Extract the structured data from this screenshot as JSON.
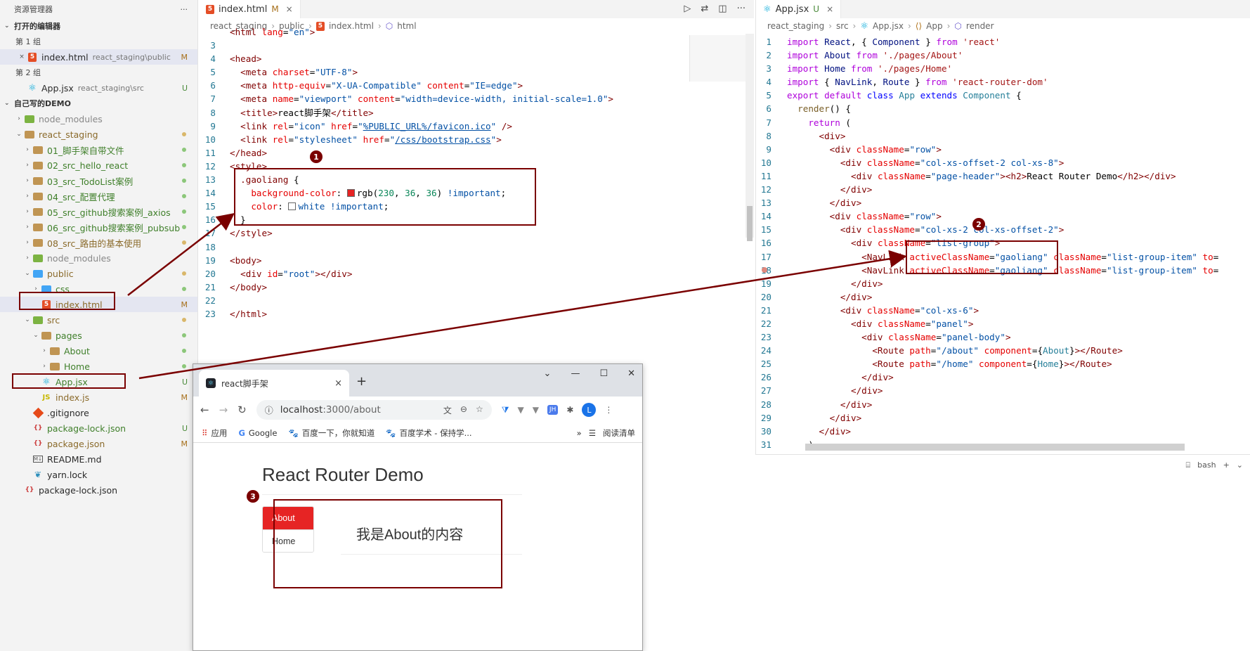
{
  "sidebar": {
    "title": "资源管理器",
    "more": "···",
    "open_editors": {
      "label": "打开的编辑器",
      "group1": "第 1 组",
      "group1_file": {
        "name": "index.html",
        "path": "react_staging\\public",
        "status": "M"
      },
      "group2": "第 2 组",
      "group2_file": {
        "name": "App.jsx",
        "path": "react_staging\\src",
        "status": "U"
      }
    },
    "workspace": {
      "label": "自己写的DEMO",
      "items": [
        {
          "name": "node_modules",
          "icon": "folder-green",
          "indent": 1,
          "chevron": "›",
          "status": ""
        },
        {
          "name": "react_staging",
          "icon": "folder",
          "indent": 1,
          "chevron": "⌄",
          "status": "dot-m"
        },
        {
          "name": "01_脚手架自带文件",
          "icon": "folder",
          "indent": 2,
          "chevron": "›",
          "status": "dot"
        },
        {
          "name": "02_src_hello_react",
          "icon": "folder",
          "indent": 2,
          "chevron": "›",
          "status": "dot"
        },
        {
          "name": "03_src_TodoList案例",
          "icon": "folder",
          "indent": 2,
          "chevron": "›",
          "status": "dot"
        },
        {
          "name": "04_src_配置代理",
          "icon": "folder",
          "indent": 2,
          "chevron": "›",
          "status": "dot"
        },
        {
          "name": "05_src_github搜索案例_axios",
          "icon": "folder",
          "indent": 2,
          "chevron": "›",
          "status": "dot"
        },
        {
          "name": "06_src_github搜索案例_pubsub",
          "icon": "folder",
          "indent": 2,
          "chevron": "›",
          "status": "dot"
        },
        {
          "name": "08_src_路由的基本使用",
          "icon": "folder",
          "indent": 2,
          "chevron": "›",
          "status": "dot-m"
        },
        {
          "name": "node_modules",
          "icon": "folder-green",
          "indent": 2,
          "chevron": "›",
          "status": ""
        },
        {
          "name": "public",
          "icon": "folder-blue",
          "indent": 2,
          "chevron": "⌄",
          "status": "dot-m"
        },
        {
          "name": "css",
          "icon": "folder-blue",
          "indent": 3,
          "chevron": "›",
          "status": "dot"
        },
        {
          "name": "index.html",
          "icon": "html",
          "indent": 3,
          "chevron": "",
          "status": "M"
        },
        {
          "name": "src",
          "icon": "folder-green",
          "indent": 2,
          "chevron": "⌄",
          "status": "dot-m"
        },
        {
          "name": "pages",
          "icon": "folder",
          "indent": 3,
          "chevron": "⌄",
          "status": "dot"
        },
        {
          "name": "About",
          "icon": "folder",
          "indent": 4,
          "chevron": "›",
          "status": "dot"
        },
        {
          "name": "Home",
          "icon": "folder",
          "indent": 4,
          "chevron": "›",
          "status": "dot"
        },
        {
          "name": "App.jsx",
          "icon": "react",
          "indent": 3,
          "chevron": "",
          "status": "U"
        },
        {
          "name": "index.js",
          "icon": "js",
          "indent": 3,
          "chevron": "",
          "status": "M"
        },
        {
          "name": ".gitignore",
          "icon": "git",
          "indent": 2,
          "chevron": "",
          "status": ""
        },
        {
          "name": "package-lock.json",
          "icon": "json",
          "indent": 2,
          "chevron": "",
          "status": "U"
        },
        {
          "name": "package.json",
          "icon": "json",
          "indent": 2,
          "chevron": "",
          "status": "M"
        },
        {
          "name": "README.md",
          "icon": "md",
          "indent": 2,
          "chevron": "",
          "status": ""
        },
        {
          "name": "yarn.lock",
          "icon": "yarn",
          "indent": 2,
          "chevron": "",
          "status": ""
        },
        {
          "name": "package-lock.json",
          "icon": "json",
          "indent": 1,
          "chevron": "",
          "status": ""
        }
      ]
    }
  },
  "editor1": {
    "tab_name": "index.html",
    "tab_status": "M",
    "breadcrumb": [
      "react_staging",
      "public",
      "index.html",
      "html"
    ],
    "lines": [
      {
        "n": "",
        "html": "<span class=\"t\">&lt;html</span> <span class=\"a\">lang</span>=<span class=\"s\">\"en\"</span><span class=\"t\">&gt;</span>"
      },
      {
        "n": "3",
        "html": ""
      },
      {
        "n": "4",
        "html": "<span class=\"t\">&lt;head&gt;</span>"
      },
      {
        "n": "5",
        "html": "  <span class=\"t\">&lt;meta</span> <span class=\"a\">charset</span>=<span class=\"s\">\"UTF-8\"</span><span class=\"t\">&gt;</span>"
      },
      {
        "n": "6",
        "html": "  <span class=\"t\">&lt;meta</span> <span class=\"a\">http-equiv</span>=<span class=\"s\">\"X-UA-Compatible\"</span> <span class=\"a\">content</span>=<span class=\"s\">\"IE=edge\"</span><span class=\"t\">&gt;</span>"
      },
      {
        "n": "7",
        "html": "  <span class=\"t\">&lt;meta</span> <span class=\"a\">name</span>=<span class=\"s\">\"viewport\"</span> <span class=\"a\">content</span>=<span class=\"s\">\"width=device-width, initial-scale=1.0\"</span><span class=\"t\">&gt;</span>"
      },
      {
        "n": "8",
        "html": "  <span class=\"t\">&lt;title&gt;</span>react脚手架<span class=\"t\">&lt;/title&gt;</span>"
      },
      {
        "n": "9",
        "html": "  <span class=\"t\">&lt;link</span> <span class=\"a\">rel</span>=<span class=\"s\">\"icon\"</span> <span class=\"a\">href</span>=<span class=\"s\">\"<u>%PUBLIC_URL%/favicon.ico</u>\"</span> <span class=\"t\">/&gt;</span>"
      },
      {
        "n": "10",
        "html": "  <span class=\"t\">&lt;link</span> <span class=\"a\">rel</span>=<span class=\"s\">\"stylesheet\"</span> <span class=\"a\">href</span>=<span class=\"s\">\"<u>/css/bootstrap.css</u>\"</span><span class=\"t\">&gt;</span>"
      },
      {
        "n": "11",
        "html": "<span class=\"t\">&lt;/head&gt;</span>"
      },
      {
        "n": "12",
        "html": "<span class=\"t\">&lt;style&gt;</span>"
      },
      {
        "n": "13",
        "html": "  <span class=\"t\">.gaoliang</span> {"
      },
      {
        "n": "14",
        "html": "    <span class=\"a\">background-color</span>: <span class=\"swatch\" style=\"background:#e62424\"></span>rgb(<span class=\"n\">230</span>, <span class=\"n\">36</span>, <span class=\"n\">36</span>) <span class=\"s\">!important</span>;"
      },
      {
        "n": "15",
        "html": "    <span class=\"a\">color</span>: <span class=\"swatch\" style=\"background:#ffffff\"></span><span class=\"s\">white</span> <span class=\"s\">!important</span>;"
      },
      {
        "n": "16",
        "html": "  }"
      },
      {
        "n": "17",
        "html": "<span class=\"t\">&lt;/style&gt;</span>"
      },
      {
        "n": "18",
        "html": ""
      },
      {
        "n": "19",
        "html": "<span class=\"t\">&lt;body&gt;</span>"
      },
      {
        "n": "20",
        "html": "  <span class=\"t\">&lt;div</span> <span class=\"a\">id</span>=<span class=\"s\">\"root\"</span><span class=\"t\">&gt;&lt;/div&gt;</span>"
      },
      {
        "n": "21",
        "html": "<span class=\"t\">&lt;/body&gt;</span>"
      },
      {
        "n": "22",
        "html": ""
      },
      {
        "n": "23",
        "html": "<span class=\"t\">&lt;/html&gt;</span>"
      }
    ]
  },
  "editor2": {
    "tab_name": "App.jsx",
    "tab_status": "U",
    "breadcrumb": [
      "react_staging",
      "src",
      "App.jsx",
      "App",
      "render"
    ],
    "lines": [
      {
        "n": "1",
        "html": "<span class=\"kw\">import</span> <span class=\"v\">React</span>, { <span class=\"v\">Component</span> } <span class=\"kw\">from</span> <span class=\"str\">'react'</span>"
      },
      {
        "n": "2",
        "html": "<span class=\"kw\">import</span> <span class=\"v\">About</span> <span class=\"kw\">from</span> <span class=\"str\">'./pages/About'</span>"
      },
      {
        "n": "3",
        "html": "<span class=\"kw\">import</span> <span class=\"v\">Home</span> <span class=\"kw\">from</span> <span class=\"str\">'./pages/Home'</span>"
      },
      {
        "n": "4",
        "html": "<span class=\"kw\">import</span> { <span class=\"v\">NavLink</span>, <span class=\"v\">Route</span> } <span class=\"kw\">from</span> <span class=\"str\">'react-router-dom'</span>"
      },
      {
        "n": "5",
        "html": "<span class=\"kw\">export</span> <span class=\"kw\">default</span> <span class=\"kb\">class</span> <span class=\"cls\">App</span> <span class=\"kb\">extends</span> <span class=\"cls\">Component</span> {"
      },
      {
        "n": "6",
        "html": "  <span class=\"p\">render</span>() {"
      },
      {
        "n": "7",
        "html": "    <span class=\"kw\">return</span> ("
      },
      {
        "n": "8",
        "html": "      <span class=\"t\">&lt;div&gt;</span>"
      },
      {
        "n": "9",
        "html": "        <span class=\"t\">&lt;div</span> <span class=\"a\">className</span>=<span class=\"s\">\"row\"</span><span class=\"t\">&gt;</span>"
      },
      {
        "n": "10",
        "html": "          <span class=\"t\">&lt;div</span> <span class=\"a\">className</span>=<span class=\"s\">\"col-xs-offset-2 col-xs-8\"</span><span class=\"t\">&gt;</span>"
      },
      {
        "n": "11",
        "html": "            <span class=\"t\">&lt;div</span> <span class=\"a\">className</span>=<span class=\"s\">\"page-header\"</span><span class=\"t\">&gt;&lt;h2&gt;</span>React Router Demo<span class=\"t\">&lt;/h2&gt;&lt;/div&gt;</span>"
      },
      {
        "n": "12",
        "html": "          <span class=\"t\">&lt;/div&gt;</span>"
      },
      {
        "n": "13",
        "html": "        <span class=\"t\">&lt;/div&gt;</span>"
      },
      {
        "n": "14",
        "html": "        <span class=\"t\">&lt;div</span> <span class=\"a\">className</span>=<span class=\"s\">\"row\"</span><span class=\"t\">&gt;</span>"
      },
      {
        "n": "15",
        "html": "          <span class=\"t\">&lt;div</span> <span class=\"a\">className</span>=<span class=\"s\">\"col-xs-2 col-xs-offset-2\"</span><span class=\"t\">&gt;</span>"
      },
      {
        "n": "16",
        "html": "            <span class=\"t\">&lt;div</span> <span class=\"a\">className</span>=<span class=\"s\">\"list-group\"</span><span class=\"t\">&gt;</span>"
      },
      {
        "n": "17",
        "html": "              <span class=\"t\">&lt;NavLink</span> <span class=\"a\">activeClassName</span>=<span class=\"s\">\"gaoliang\"</span> <span class=\"a\">className</span>=<span class=\"s\">\"list-group-item\"</span> <span class=\"a\">to</span>="
      },
      {
        "n": "18",
        "html": "              <span class=\"t\">&lt;NavLink</span> <span class=\"a\">activeClassName</span>=<span class=\"s\">\"gaoliang\"</span> <span class=\"a\">className</span>=<span class=\"s\">\"list-group-item\"</span> <span class=\"a\">to</span>="
      },
      {
        "n": "19",
        "html": "            <span class=\"t\">&lt;/div&gt;</span>"
      },
      {
        "n": "20",
        "html": "          <span class=\"t\">&lt;/div&gt;</span>"
      },
      {
        "n": "21",
        "html": "          <span class=\"t\">&lt;div</span> <span class=\"a\">className</span>=<span class=\"s\">\"col-xs-6\"</span><span class=\"t\">&gt;</span>"
      },
      {
        "n": "22",
        "html": "            <span class=\"t\">&lt;div</span> <span class=\"a\">className</span>=<span class=\"s\">\"panel\"</span><span class=\"t\">&gt;</span>"
      },
      {
        "n": "23",
        "html": "              <span class=\"t\">&lt;div</span> <span class=\"a\">className</span>=<span class=\"s\">\"panel-body\"</span><span class=\"t\">&gt;</span>"
      },
      {
        "n": "24",
        "html": "                <span class=\"t\">&lt;Route</span> <span class=\"a\">path</span>=<span class=\"s\">\"/about\"</span> <span class=\"a\">component</span>={<span class=\"cls\">About</span>}<span class=\"t\">&gt;&lt;/Route&gt;</span>"
      },
      {
        "n": "25",
        "html": "                <span class=\"t\">&lt;Route</span> <span class=\"a\">path</span>=<span class=\"s\">\"/home\"</span> <span class=\"a\">component</span>={<span class=\"cls\">Home</span>}<span class=\"t\">&gt;&lt;/Route&gt;</span>"
      },
      {
        "n": "26",
        "html": "              <span class=\"t\">&lt;/div&gt;</span>"
      },
      {
        "n": "27",
        "html": "            <span class=\"t\">&lt;/div&gt;</span>"
      },
      {
        "n": "28",
        "html": "          <span class=\"t\">&lt;/div&gt;</span>"
      },
      {
        "n": "29",
        "html": "        <span class=\"t\">&lt;/div&gt;</span>"
      },
      {
        "n": "30",
        "html": "      <span class=\"t\">&lt;/div&gt;</span>"
      },
      {
        "n": "31",
        "html": "    )"
      }
    ]
  },
  "terminal": {
    "shell": "bash",
    "add": "+",
    "more": "⌄"
  },
  "browser": {
    "tab_title": "react脚手架",
    "new_tab": "+",
    "url_host": "localhost",
    "url_rest": ":3000/about",
    "bookmarks": [
      "应用",
      "Google",
      "百度一下，你就知道",
      "百度学术 - 保持学..."
    ],
    "reading_list": "阅读清单",
    "avatar": "L",
    "ext_jh": "JH",
    "page": {
      "title": "React Router Demo",
      "nav": [
        {
          "label": "About",
          "active": true
        },
        {
          "label": "Home",
          "active": false
        }
      ],
      "content": "我是About的内容"
    }
  },
  "annotations": [
    "1",
    "2",
    "3"
  ],
  "colors": {
    "annotation": "#7a0000",
    "active_link": "#e62424"
  }
}
